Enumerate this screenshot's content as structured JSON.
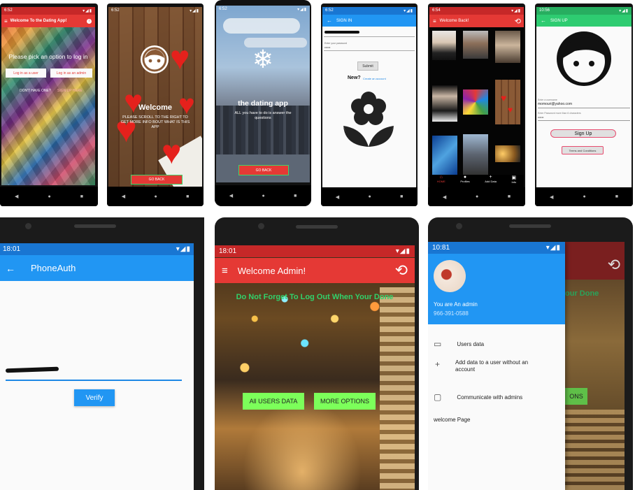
{
  "p1": {
    "time": "6:52",
    "title": "Welcome To the Dating App!",
    "prompt": "Please pick an option to log in",
    "user_btn": "Log in as a user",
    "admin_btn": "Log in as an admin",
    "dont_have": "DON'T HAVE ONE?",
    "signup_link": "SIGN UP HERE"
  },
  "p2": {
    "time": "6:52",
    "welcome": "Welcome",
    "desc": "PLEASE SCROLL TO THE RIGHT TO GET MORE INFO BOUT WHAT IS THIS APP",
    "go_back": "GO BACK"
  },
  "p3": {
    "time": "6:52",
    "title": "the dating app",
    "desc": "ALL you have to do is answer the questions",
    "go_back": "GO BACK"
  },
  "p4": {
    "time": "6:52",
    "title": "SIGN IN",
    "password_label": "Enter your password",
    "password_value": "••••••",
    "submit": "Submit",
    "new": "New?",
    "create": "Create an account"
  },
  "p5": {
    "time": "6:54",
    "title": "Welcome Back!",
    "nav": [
      "HOME",
      "Profiles",
      "Add Data",
      "Info"
    ]
  },
  "p6": {
    "time": "10:56",
    "title": "SIGN UP",
    "email_label": "Enter a username",
    "email_value": "momouri@yahoo.com",
    "password_label": "Enter Password more than 6 characters",
    "password_value": "••••••",
    "signup": "Sign Up",
    "terms": "Terms and Conditions"
  },
  "p7": {
    "time": "18:01",
    "title": "PhoneAuth",
    "verify": "Verify"
  },
  "p8": {
    "time": "18:01",
    "title": "Welcome Admin!",
    "banner": "Do Not Forget To Log Out When Your Done",
    "btn_all": "All USERS DATA",
    "btn_more": "MORE OPTIONS"
  },
  "p9": {
    "time": "10:81",
    "role": "You are An admin",
    "phone": "966-391-0588",
    "items": [
      "Users data",
      "Add data to a user without an account",
      "Communicate with admins"
    ],
    "footer": "welcome Page",
    "peek_banner": "our Done",
    "peek_btn": "ONS"
  },
  "colors": {
    "red": "#e53935",
    "blue": "#2196f3",
    "green": "#2ecc71",
    "lime": "#7cff5a"
  }
}
